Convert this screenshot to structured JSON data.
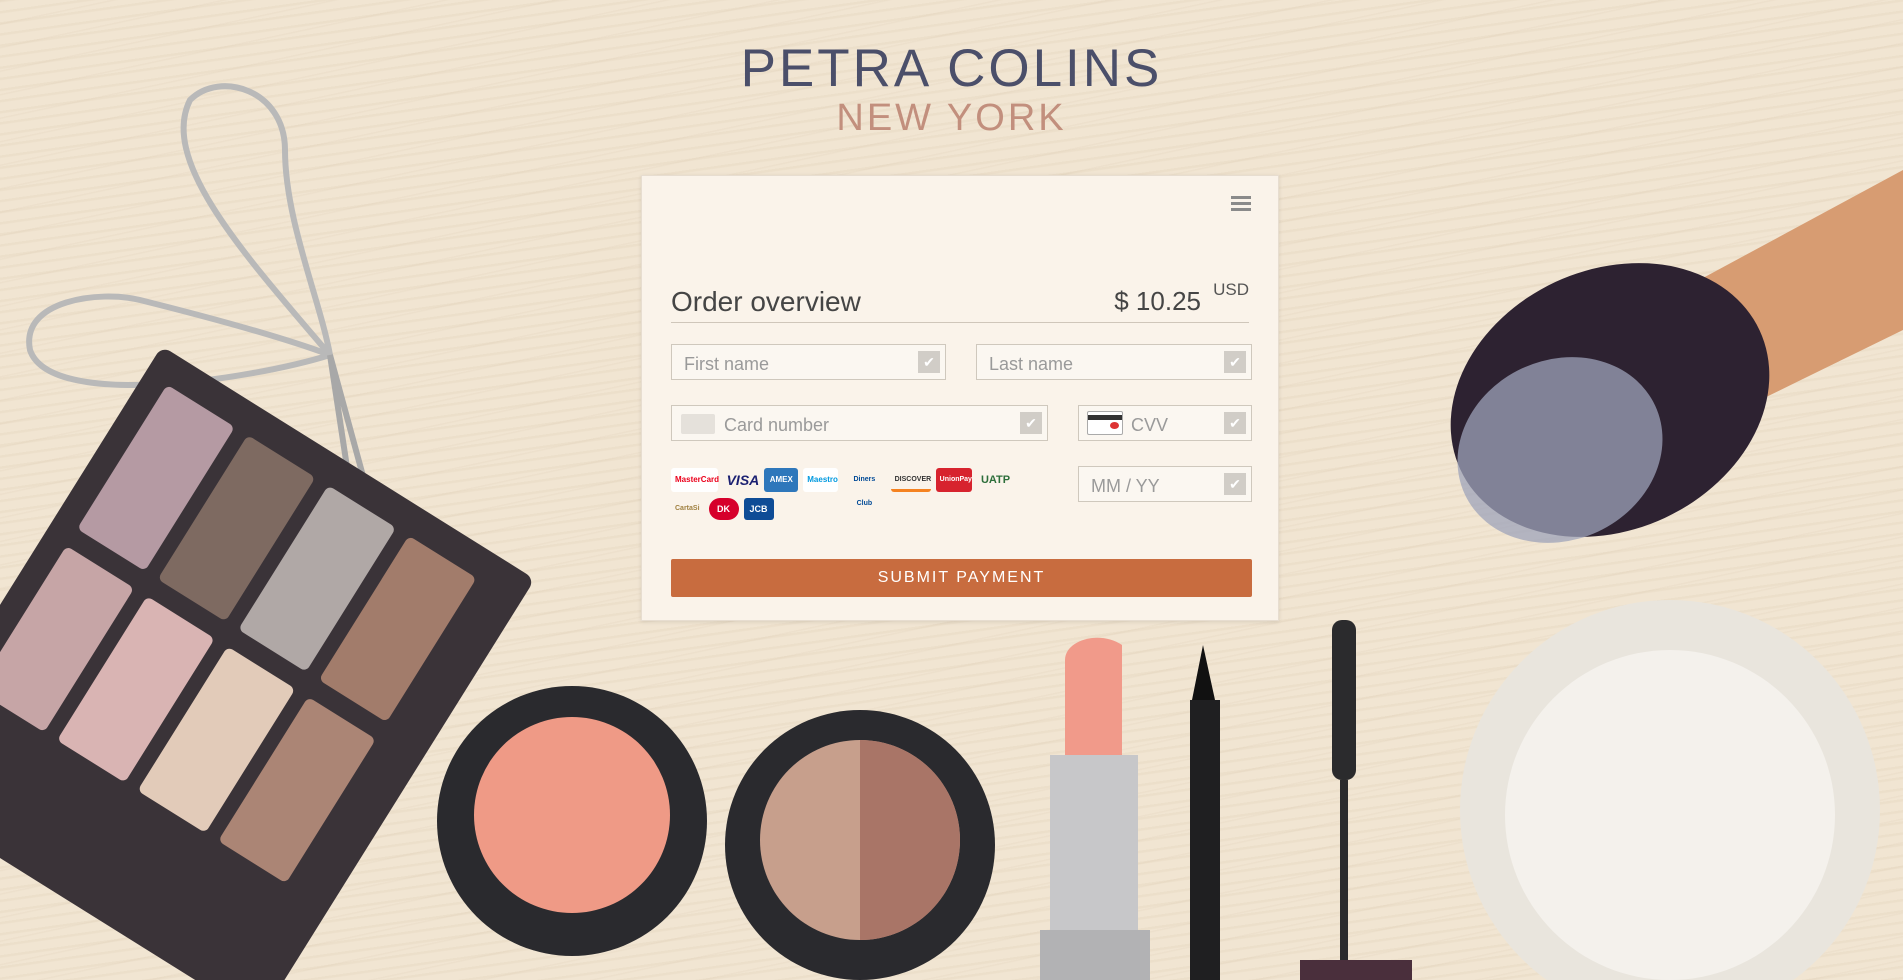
{
  "brand": {
    "name": "PETRA COLINS",
    "city": "NEW YORK"
  },
  "order": {
    "title": "Order overview",
    "amount": "$ 10.25",
    "currency": "USD"
  },
  "form": {
    "first_name_placeholder": "First name",
    "last_name_placeholder": "Last name",
    "card_number_placeholder": "Card number",
    "cvv_placeholder": "CVV",
    "expiry_placeholder": "MM / YY",
    "submit_label": "SUBMIT PAYMENT",
    "check_glyph": "✔"
  },
  "payment_brands": [
    {
      "name": "Mastercard",
      "label": "MasterCard",
      "icon": "mastercard-icon",
      "color": "#eb001b"
    },
    {
      "name": "Visa",
      "label": "VISA",
      "icon": "visa-icon",
      "color": "#1a1f71"
    },
    {
      "name": "American Express",
      "label": "AMEX",
      "icon": "amex-icon",
      "color": "#2e77bb"
    },
    {
      "name": "Maestro",
      "label": "Maestro",
      "icon": "maestro-icon",
      "color": "#0099df"
    },
    {
      "name": "Diners Club",
      "label": "Diners Club",
      "icon": "diners-icon",
      "color": "#004a97"
    },
    {
      "name": "Discover",
      "label": "DISCOVER",
      "icon": "discover-icon",
      "color": "#f58220"
    },
    {
      "name": "UnionPay",
      "label": "UnionPay",
      "icon": "unionpay-icon",
      "color": "#d7232e"
    },
    {
      "name": "UATP",
      "label": "UATP",
      "icon": "uatp-icon",
      "color": "#2c6e3a"
    },
    {
      "name": "CartaSi",
      "label": "CartaSi",
      "icon": "cartasi-icon",
      "color": "#f4a300"
    },
    {
      "name": "Dankort",
      "label": "DK",
      "icon": "dankort-icon",
      "color": "#d6002b"
    },
    {
      "name": "JCB",
      "label": "JCB",
      "icon": "jcb-icon",
      "color": "#0e4c96"
    }
  ],
  "colors": {
    "accent": "#c86c3f",
    "brand_name": "#4b4f6a",
    "brand_city": "#c28f7d",
    "card_bg": "#faf3ea"
  }
}
